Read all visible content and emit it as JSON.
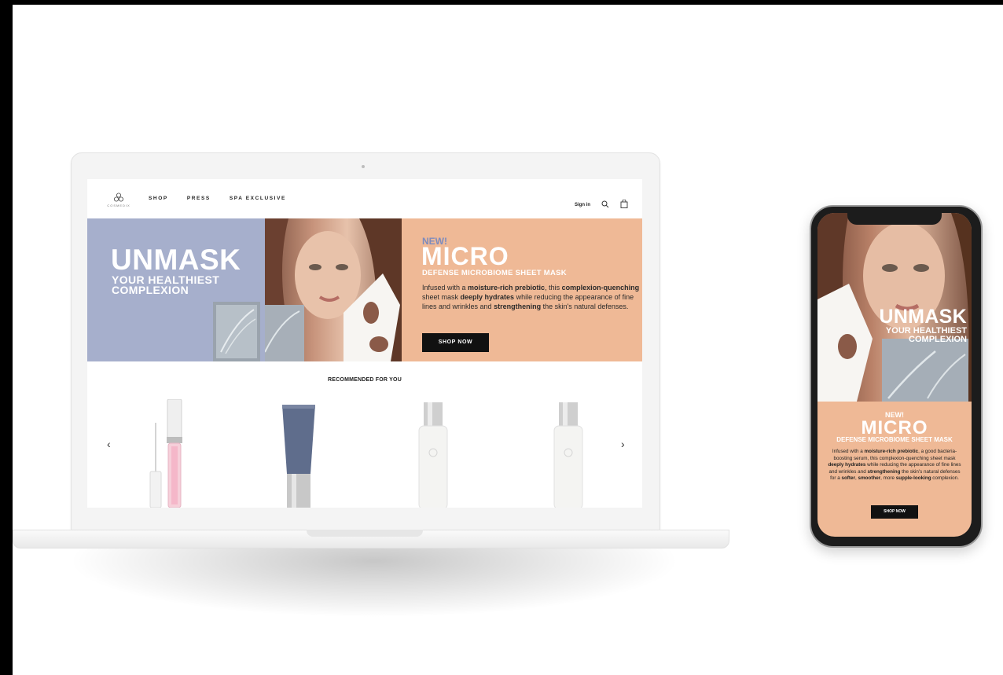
{
  "brand": {
    "name": "COSMEDIX"
  },
  "nav": {
    "items": [
      "SHOP",
      "PRESS",
      "SPA EXCLUSIVE"
    ]
  },
  "header": {
    "signin": "Sign in"
  },
  "hero": {
    "left_title": "UNMASK",
    "left_sub_1": "YOUR HEALTHIEST",
    "left_sub_2": "COMPLEXION",
    "new": "NEW!",
    "micro": "MICRO",
    "micro_sub": "DEFENSE MICROBIOME SHEET MASK",
    "desc": {
      "p1": "Infused with a ",
      "b1": "moisture-rich prebiotic",
      "p2": ", this ",
      "b2": "complexion-quenching",
      "p3": " sheet mask ",
      "b3": "deeply hydrates",
      "p4": " while reducing the appearance of fine lines and wrinkles and ",
      "b4": "strengthening",
      "p5": " the skin's natural defenses."
    },
    "cta": "SHOP NOW"
  },
  "recommendations": {
    "title": "RECOMMENDED FOR YOU",
    "prev": "‹",
    "next": "›"
  },
  "mobile": {
    "title": "UNMASK",
    "sub_1": "YOUR HEALTHIEST",
    "sub_2": "COMPLEXION",
    "new": "NEW!",
    "micro": "MICRO",
    "micro_sub": "DEFENSE MICROBIOME SHEET MASK",
    "desc": {
      "p1": "Infused with a ",
      "b1": "moisture-rich prebiotic",
      "p2": ", a good bacteria-boosting serum, this complexion-quenching sheet mask ",
      "b2": "deeply hydrates",
      "p3": " while reducing the appearance of fine lines and wrinkles and ",
      "b3": "strengthening",
      "p4": " the skin's natural defenses for a ",
      "b4": "softer",
      "p5": ", ",
      "b5": "smoother",
      "p6": ", more ",
      "b6": "supple-looking",
      "p7": " complexion."
    },
    "cta": "SHOP NOW"
  },
  "colors": {
    "lavender": "#a6afcc",
    "peach": "#efb996",
    "accent_blue": "#7d8bbd"
  }
}
